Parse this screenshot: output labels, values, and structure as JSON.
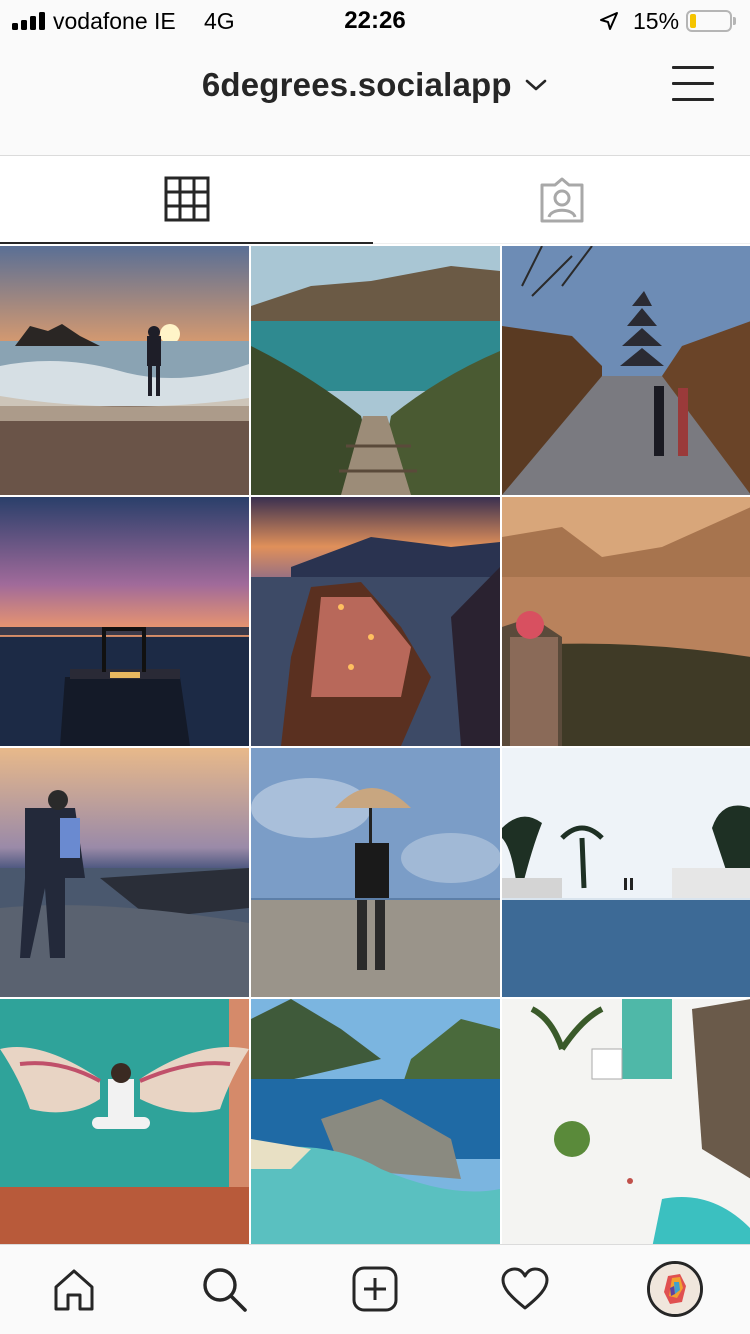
{
  "status_bar": {
    "carrier": "vodafone IE",
    "network": "4G",
    "time": "22:26",
    "battery_percent": "15%",
    "battery_level": 0.15,
    "icons": [
      "signal-icon",
      "location-arrow-icon",
      "battery-icon"
    ]
  },
  "header": {
    "account_name": "6degrees.socialapp",
    "icons": [
      "chevron-down-icon",
      "menu-icon"
    ]
  },
  "tabs": [
    {
      "icon": "grid-icon",
      "selected": true
    },
    {
      "icon": "tagged-person-icon",
      "selected": false
    }
  ],
  "grid": {
    "tiles": [
      {
        "scene": "sunset-beach-walker"
      },
      {
        "scene": "coastal-stairway"
      },
      {
        "scene": "kyoto-pagoda-street"
      },
      {
        "scene": "twilight-pier"
      },
      {
        "scene": "cliff-village-sunset"
      },
      {
        "scene": "valley-overlook-hiker"
      },
      {
        "scene": "rocky-shore-backpacker"
      },
      {
        "scene": "umbrella-puddle-reflection"
      },
      {
        "scene": "infinity-pool-palms"
      },
      {
        "scene": "angel-wings-mural"
      },
      {
        "scene": "tropical-island-lagoon"
      },
      {
        "scene": "aerial-beach-resort"
      }
    ]
  },
  "bottom_nav": [
    {
      "icon": "home-icon"
    },
    {
      "icon": "search-icon"
    },
    {
      "icon": "new-post-icon"
    },
    {
      "icon": "heart-icon"
    },
    {
      "icon": "profile-avatar"
    }
  ],
  "colors": {
    "bar_background": "#fafafa",
    "text": "#262626",
    "divider": "#dbdbdb",
    "battery_fill": "#f5c400"
  }
}
